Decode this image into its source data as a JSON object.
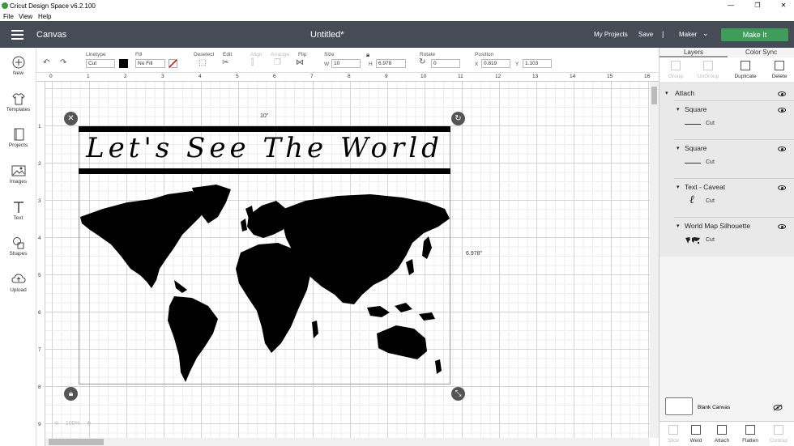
{
  "app": {
    "title": "Cricut Design Space  v6.2.100",
    "window_controls": [
      "—",
      "❐",
      "✕"
    ]
  },
  "menu": [
    "File",
    "View",
    "Help"
  ],
  "header": {
    "canvas_label": "Canvas",
    "doc_title": "Untitled*",
    "my_projects": "My Projects",
    "save": "Save",
    "separator": "|",
    "machine": "Maker",
    "make_it": "Make It",
    "colors": {
      "bar": "#454c56",
      "make_it": "#3f9d5a"
    }
  },
  "toolbar": {
    "linetype_label": "Linetype",
    "linetype_value": "Cut",
    "fill_label": "Fill",
    "fill_value": "No Fill",
    "deselect": "Deselect",
    "edit": "Edit",
    "align": "Align",
    "arrange": "Arrange",
    "flip": "Flip",
    "size_label": "Size",
    "w_label": "W",
    "w_value": "10",
    "h_label": "H",
    "h_value": "6.978",
    "rotate_label": "Rotate",
    "rotate_value": "0",
    "position_label": "Position",
    "x_label": "X",
    "x_value": "0.819",
    "y_label": "Y",
    "y_value": "1.103"
  },
  "sidebar": {
    "items": [
      {
        "label": "New",
        "icon": "plus-icon"
      },
      {
        "label": "Templates",
        "icon": "shirt-icon"
      },
      {
        "label": "Projects",
        "icon": "book-icon"
      },
      {
        "label": "Images",
        "icon": "image-icon"
      },
      {
        "label": "Text",
        "icon": "text-icon"
      },
      {
        "label": "Shapes",
        "icon": "shapes-icon"
      },
      {
        "label": "Upload",
        "icon": "upload-icon"
      }
    ]
  },
  "ruler": {
    "top": [
      "0",
      "1",
      "2",
      "3",
      "4",
      "5",
      "6",
      "7",
      "8",
      "9",
      "10",
      "11",
      "12",
      "13",
      "14",
      "15",
      "16"
    ],
    "left": [
      "1",
      "2",
      "3",
      "4",
      "5",
      "6",
      "7",
      "8",
      "9"
    ]
  },
  "canvas": {
    "headline": "Let's See The World",
    "width_label": "10\"",
    "height_label": "6.978\"",
    "zoom": "100%"
  },
  "panel": {
    "tabs": [
      "Layers",
      "Color Sync"
    ],
    "tools": [
      {
        "label": "Group",
        "enabled": false
      },
      {
        "label": "UnGroup",
        "enabled": false
      },
      {
        "label": "Duplicate",
        "enabled": true
      },
      {
        "label": "Delete",
        "enabled": true
      }
    ],
    "attach_label": "Attach",
    "layers": [
      {
        "name": "Square",
        "op": "Cut"
      },
      {
        "name": "Square",
        "op": "Cut"
      },
      {
        "name": "Text - Caveat",
        "op": "Cut"
      },
      {
        "name": "World Map Silhouette",
        "op": "Cut"
      }
    ],
    "blank_canvas": "Blank Canvas",
    "bottom_tools": [
      {
        "label": "Slice",
        "enabled": false
      },
      {
        "label": "Weld",
        "enabled": true
      },
      {
        "label": "Attach",
        "enabled": true
      },
      {
        "label": "Flatten",
        "enabled": true
      },
      {
        "label": "Contour",
        "enabled": false
      }
    ]
  }
}
